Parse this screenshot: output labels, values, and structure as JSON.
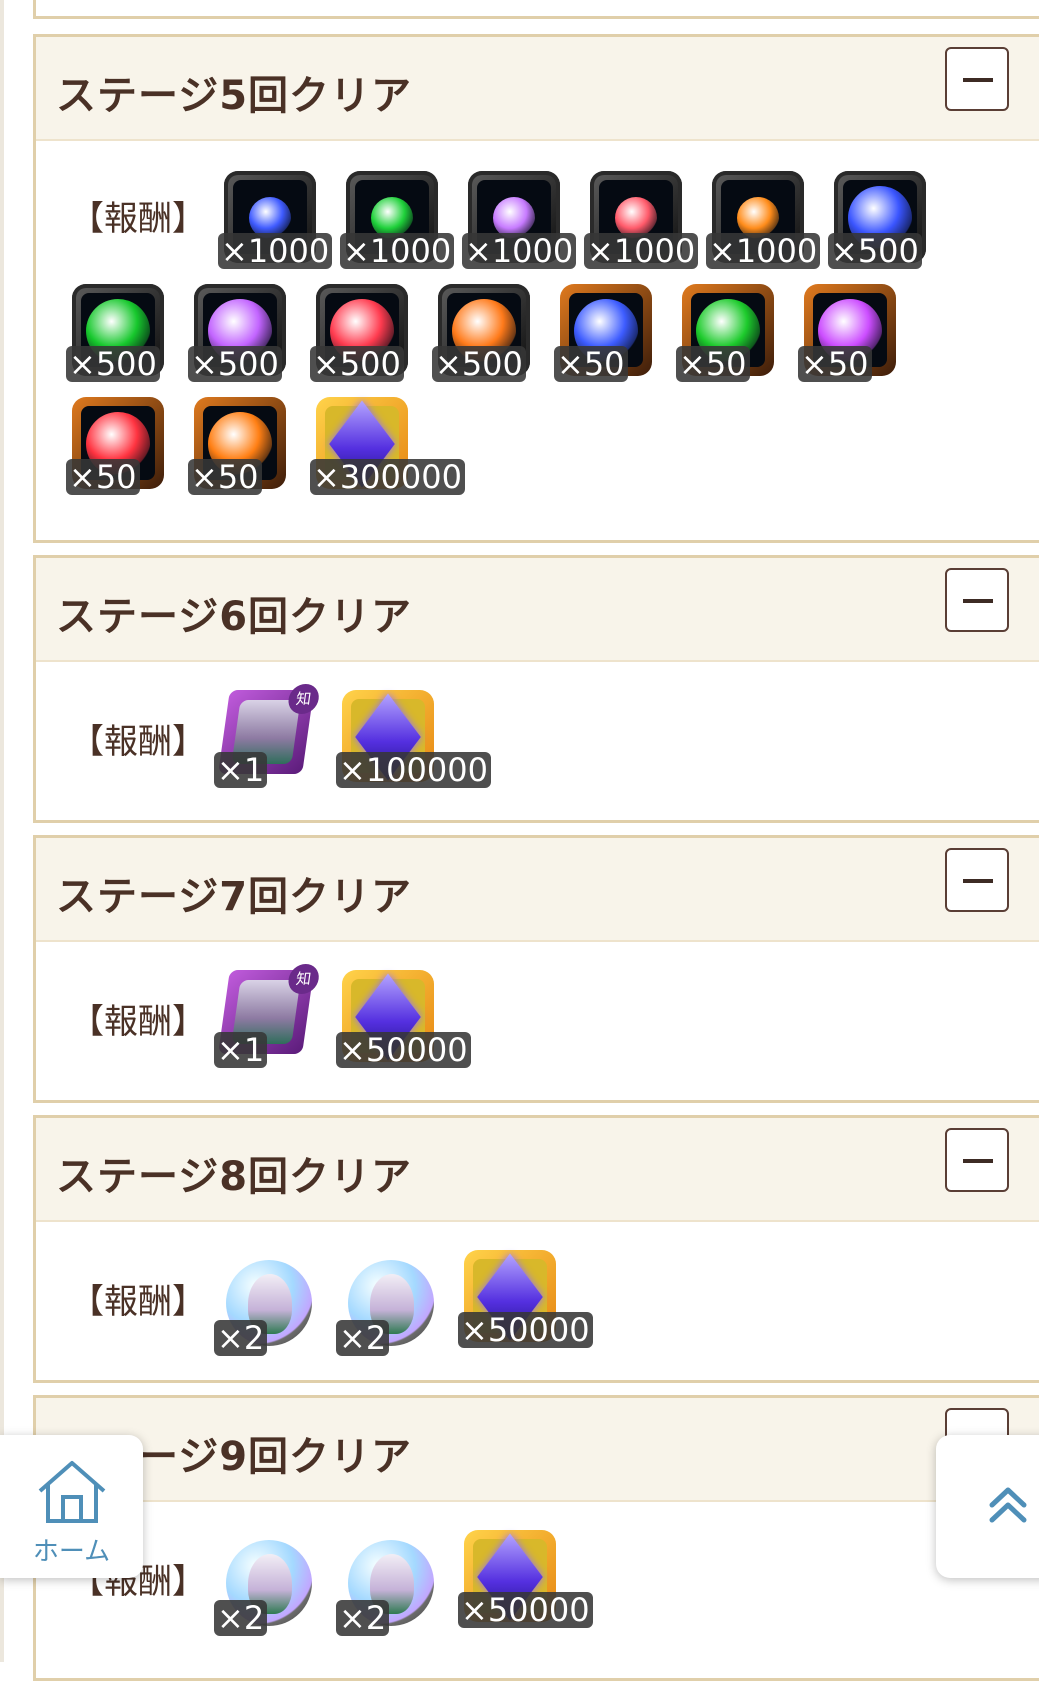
{
  "reward_label": "【報酬】",
  "toggle_symbol": "minus",
  "sections": [
    {
      "title": "ステージ5回クリア",
      "rewards": [
        {
          "type": "orb-small",
          "color": "#3f5bff",
          "count": "×1000"
        },
        {
          "type": "orb-small",
          "color": "#1fd13a",
          "count": "×1000"
        },
        {
          "type": "orb-small",
          "color": "#c77bff",
          "count": "×1000"
        },
        {
          "type": "orb-small",
          "color": "#ff5a6a",
          "count": "×1000"
        },
        {
          "type": "orb-small",
          "color": "#ff8c1a",
          "count": "×1000"
        },
        {
          "type": "orb-medium",
          "color": "#3a55ff",
          "count": "×500"
        },
        {
          "type": "orb-medium",
          "color": "#17c82d",
          "count": "×500"
        },
        {
          "type": "orb-medium",
          "color": "#c264ff",
          "count": "×500"
        },
        {
          "type": "orb-medium",
          "color": "#ff3b4f",
          "count": "×500"
        },
        {
          "type": "orb-medium",
          "color": "#ff7a1a",
          "count": "×500"
        },
        {
          "type": "orb-large",
          "color": "#3d5cff",
          "count": "×50"
        },
        {
          "type": "orb-large",
          "color": "#1dcb2c",
          "count": "×50"
        },
        {
          "type": "orb-large",
          "color": "#cc4dff",
          "count": "×50"
        },
        {
          "type": "orb-large",
          "color": "#ff3340",
          "count": "×50"
        },
        {
          "type": "orb-large",
          "color": "#ff7f14",
          "count": "×50"
        },
        {
          "type": "zeni-crystal",
          "count": "×300000"
        }
      ]
    },
    {
      "title": "ステージ6回クリア",
      "rewards": [
        {
          "type": "character-card",
          "attribute": "知",
          "count": "×1"
        },
        {
          "type": "zeni-crystal",
          "count": "×100000"
        }
      ]
    },
    {
      "title": "ステージ7回クリア",
      "rewards": [
        {
          "type": "character-card",
          "attribute": "知",
          "count": "×1"
        },
        {
          "type": "zeni-crystal",
          "count": "×50000"
        }
      ]
    },
    {
      "title": "ステージ8回クリア",
      "rewards": [
        {
          "type": "support-medal",
          "count": "×2"
        },
        {
          "type": "support-medal",
          "count": "×2"
        },
        {
          "type": "zeni-crystal",
          "count": "×50000"
        }
      ]
    },
    {
      "title": "ステージ9回クリア",
      "rewards": [
        {
          "type": "support-medal",
          "count": "×2"
        },
        {
          "type": "support-medal",
          "count": "×2"
        },
        {
          "type": "zeni-crystal",
          "count": "×50000"
        }
      ]
    }
  ],
  "floating": {
    "home_label": "ホーム",
    "home_icon": "house-icon",
    "top_icon": "double-chevron-up-icon",
    "accent": "#4f8fb8"
  }
}
